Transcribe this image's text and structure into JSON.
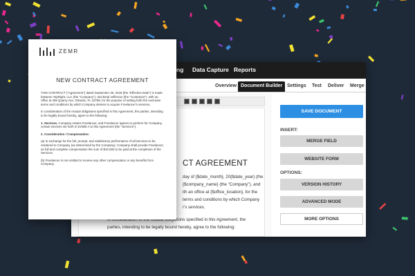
{
  "topnav": {
    "items": [
      "ng",
      "Data Capture",
      "Reports"
    ]
  },
  "tabs": [
    {
      "label": "Overview",
      "active": false
    },
    {
      "label": "Document Builder",
      "active": true
    },
    {
      "label": "Settings",
      "active": false
    },
    {
      "label": "Test",
      "active": false
    },
    {
      "label": "Deliver",
      "active": false
    },
    {
      "label": "Merge",
      "active": false
    }
  ],
  "editor": {
    "title": "CT AGREEMENT",
    "lines": [
      "day of {$date_month}, 20{$date_year} (the",
      "{$company_name} (the \"Company\"), and",
      "ith an office at {$office_location}, for the",
      "terms and conditions by which Company",
      "r's services."
    ],
    "para_lines": [
      "In consideration of the mutual obligations specified in this Agreement, the",
      "parties, intending to be legally bound hereby, agree to the following:"
    ]
  },
  "panel": {
    "save_label": "SAVE DOCUMENT",
    "insert_label": "INSERT:",
    "merge_field_label": "MERGE FIELD",
    "website_form_label": "WEBSITE FORM",
    "options_label": "OPTIONS:",
    "version_history_label": "VERSION HISTORY",
    "advanced_mode_label": "ADVANCED MODE",
    "more_options_label": "MORE OPTIONS"
  },
  "document": {
    "logo_text": "ZEMR",
    "title": "NEW CONTRACT AGREEMENT",
    "intro": "THIS CONTRACT (\"Agreement\") dated September 30, 2018 (the \"Effective Date\") is made between TopRight, LLC (the \"Company\"), and Brad Jefferson (the \"Contractor\"), with an office at 408 Quarry Ave, Orlando, FL 32789, for the purpose of setting forth the exclusive terms and conditions by which Company desires to acquire Freelancer's services.",
    "consideration": "In consideration of the mutual obligations specified in this Agreement, the parties, intending to be legally bound hereby, agree to the following:",
    "services_heading": "1. Services.",
    "services_text": "Company retains Freelancer, and Freelancer agrees to perform for Company, certain services set forth in Exhibit A to this Agreement (the \"Services\").",
    "comp_heading": "2. Consideration / Compensation:",
    "comp_a": "(a) In exchange for the full, prompt, and satisfactory performance of all Services to be rendered to Company (as determined by the Company), Company shall provide Freelancer, as full and complete compensation the sum of $10,000 to be paid at the completion of the Services.",
    "comp_b": "(b) Freelancer is not entitled to receive any other compensation or any benefits from Company."
  },
  "colors": {
    "background": "#1f2a38",
    "topnav": "#1c1c1c",
    "primary_button": "#2d8fe3",
    "secondary_button": "#d7d7d7",
    "confetti": [
      "#e8288c",
      "#f5a623",
      "#3c8bd9",
      "#7b3fc4",
      "#f2e232",
      "#3cc46f",
      "#e84444"
    ]
  }
}
